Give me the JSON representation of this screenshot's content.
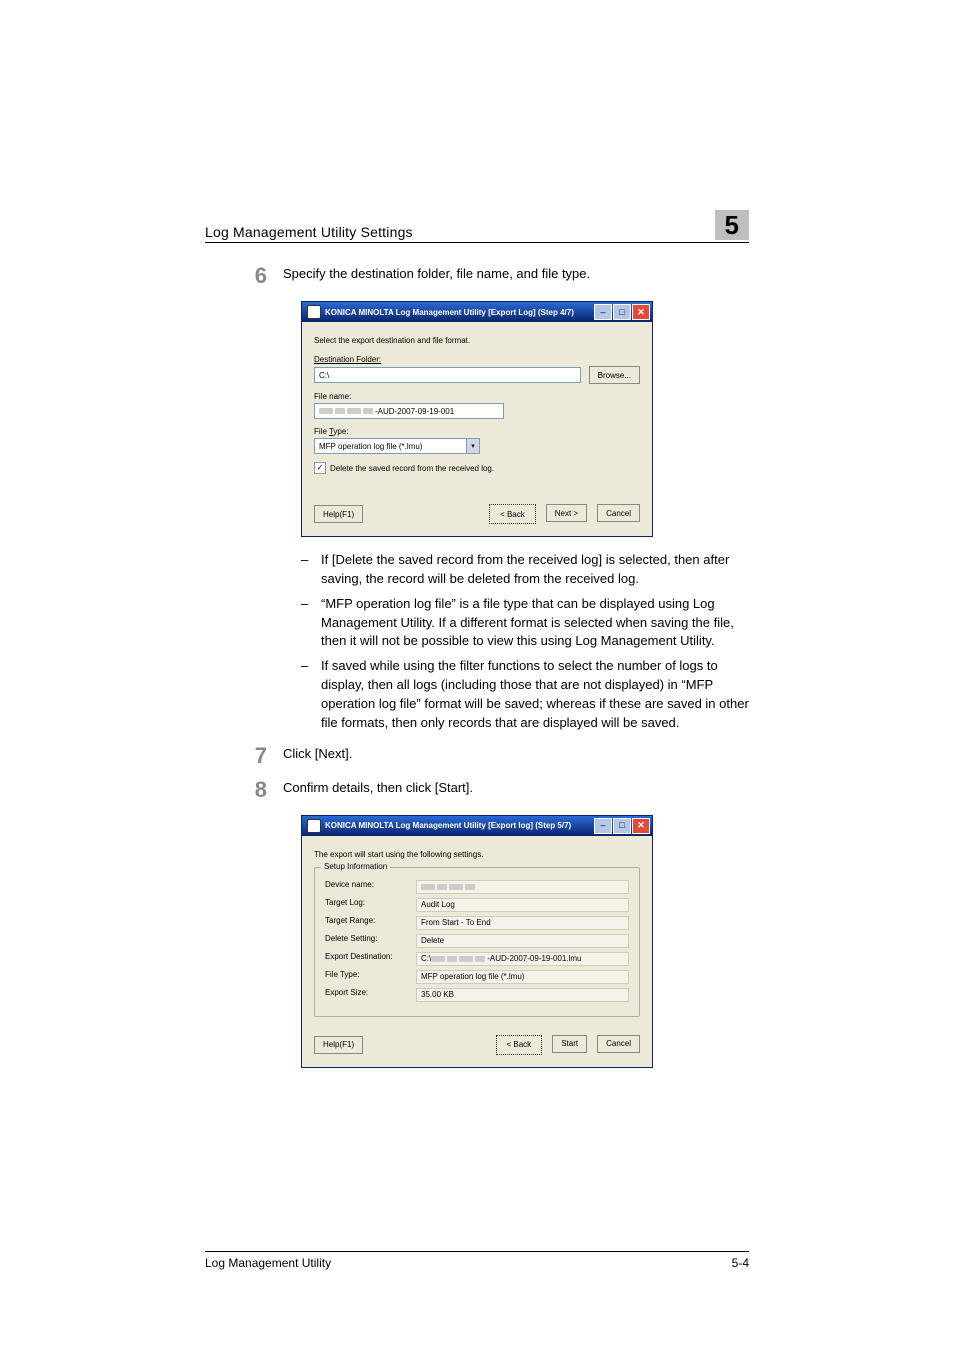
{
  "header": {
    "title": "Log Management Utility Settings",
    "chapter": "5"
  },
  "footer": {
    "left": "Log Management Utility",
    "right": "5-4"
  },
  "steps": {
    "s6": {
      "num": "6",
      "text": "Specify the destination folder, file name, and file type."
    },
    "s7": {
      "num": "7",
      "text": "Click [Next]."
    },
    "s8": {
      "num": "8",
      "text": "Confirm details, then click [Start]."
    }
  },
  "bullets": {
    "b1": "If [Delete the saved record from the received log] is selected, then after saving, the record will be deleted from the received log.",
    "b2": "“MFP operation log file” is a file type that can be displayed using Log Management Utility. If a different format is selected when saving the file, then it will not be possible to view this using Log Management Utility.",
    "b3": "If saved while using the filter functions to select the number of logs to display, then all logs (including those that are not displayed) in “MFP operation log file” format will be saved; whereas if these are saved in other file formats, then only records that are displayed will be saved."
  },
  "dialog1": {
    "title": "KONICA MINOLTA Log Management Utility [Export Log] (Step 4/7)",
    "intro": "Select the export destination and file format.",
    "dest_label": "Destination Folder:",
    "dest_value": "C:\\",
    "browse": "Browse...",
    "filename_label": "File name:",
    "filename_value": "-AUD-2007-09-19-001",
    "filetype_label": "File Type:",
    "filetype_value": "MFP operation log file (*.lmu)",
    "check_label": "Delete the saved record from the received log.",
    "help": "Help(F1)",
    "back": "< Back",
    "next": "Next >",
    "cancel": "Cancel"
  },
  "dialog2": {
    "title": "KONICA MINOLTA Log Management Utility [Export log] (Step 5/7)",
    "intro": "The export will start using the following settings.",
    "group_label": "Setup Information",
    "rows": {
      "device_k": "Device name:",
      "device_v": "",
      "target_log_k": "Target Log:",
      "target_log_v": "Audit Log",
      "target_range_k": "Target Range:",
      "target_range_v": "From Start - To End",
      "delete_k": "Delete Setting:",
      "delete_v": "Delete",
      "dest_k": "Export Destination:",
      "dest_v": "-AUD-2007-09-19-001.lmu",
      "dest_v_prefix": "C:\\",
      "filetype_k": "File Type:",
      "filetype_v": "MFP operation log file (*.lmu)",
      "size_k": "Export Size:",
      "size_v": "35.00 KB"
    },
    "help": "Help(F1)",
    "back": "< Back",
    "start": "Start",
    "cancel": "Cancel"
  }
}
